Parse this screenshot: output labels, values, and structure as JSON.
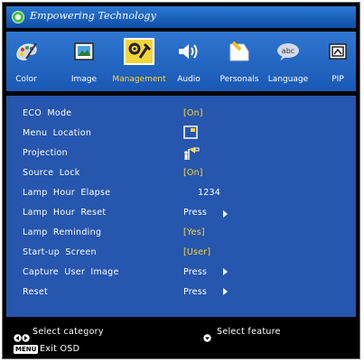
{
  "title": "Empowering Technology",
  "tabs": [
    {
      "label": "Color",
      "icon": "color-icon"
    },
    {
      "label": "Image",
      "icon": "image-icon"
    },
    {
      "label": "Management",
      "icon": "management-icon",
      "active": true
    },
    {
      "label": "Audio",
      "icon": "audio-icon"
    },
    {
      "label": "Personals",
      "icon": "personals-icon"
    },
    {
      "label": "Language",
      "icon": "language-icon"
    },
    {
      "label": "PIP",
      "icon": "pip-icon"
    }
  ],
  "rows": [
    {
      "name": "ECO  Mode",
      "value": "[On]"
    },
    {
      "name": "Menu  Location",
      "value": "",
      "icon": "menu-location-icon"
    },
    {
      "name": "Projection",
      "value": "",
      "icon": "projection-icon"
    },
    {
      "name": "Source  Lock",
      "value": "[On]"
    },
    {
      "name": "Lamp  Hour  Elapse",
      "value": "1234"
    },
    {
      "name": "Lamp  Hour  Reset",
      "value": "Press"
    },
    {
      "name": "Lamp  Reminding",
      "value": "[Yes]"
    },
    {
      "name": "Start-up  Screen",
      "value": "[User]"
    },
    {
      "name": "Capture  User  Image",
      "value": "Press"
    },
    {
      "name": "Reset",
      "value": "Press"
    }
  ],
  "footer": {
    "select_category": "Select category",
    "select_feature": "Select feature",
    "menu_key": "MENU",
    "exit": "Exit OSD"
  },
  "colors": {
    "panel": "#2656ad",
    "highlight": "#ffd43d",
    "tab_bar": "#1f5fbe"
  }
}
